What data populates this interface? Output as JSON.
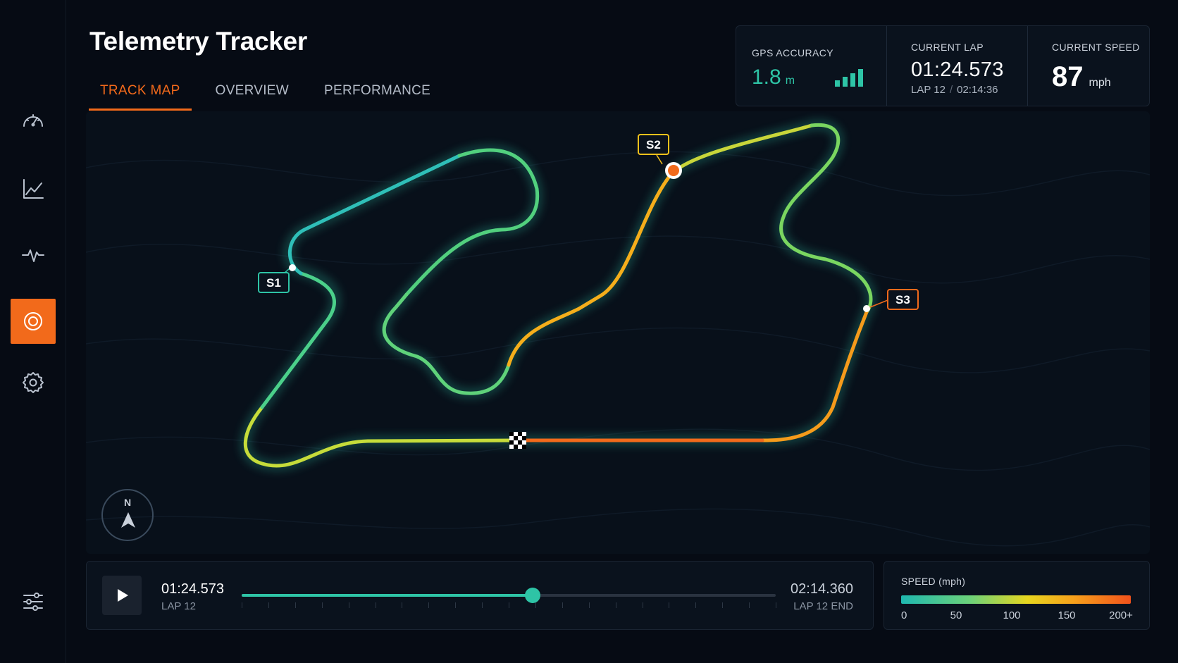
{
  "app": {
    "title": "Telemetry Tracker"
  },
  "sidebar": {
    "items": [
      {
        "id": "dashboard",
        "icon": "speedometer-icon",
        "active": false
      },
      {
        "id": "analytics",
        "icon": "line-chart-icon",
        "active": false
      },
      {
        "id": "telemetry",
        "icon": "pulse-icon",
        "active": false
      },
      {
        "id": "track",
        "icon": "target-icon",
        "active": true
      },
      {
        "id": "settings",
        "icon": "gear-icon",
        "active": false
      },
      {
        "id": "filters",
        "icon": "sliders-icon",
        "active": false
      }
    ]
  },
  "tabs": [
    {
      "label": "TRACK MAP",
      "active": true
    },
    {
      "label": "OVERVIEW",
      "active": false
    },
    {
      "label": "PERFORMANCE",
      "active": false
    }
  ],
  "stats": {
    "gps": {
      "label": "GPS ACCURACY",
      "value": "1.8",
      "unit": "m",
      "signal_bars": 4
    },
    "lap": {
      "label": "CURRENT LAP",
      "time": "01:24.573",
      "lap": "LAP 12",
      "total": "02:14:36"
    },
    "speed": {
      "label": "CURRENT SPEED",
      "value": "87",
      "unit": "mph"
    }
  },
  "map": {
    "sectors": [
      {
        "label": "S1",
        "color": "#2ec4a6"
      },
      {
        "label": "S2",
        "color": "#f5c21b"
      },
      {
        "label": "S3",
        "color": "#f26a1b"
      }
    ],
    "compass": {
      "label": "N"
    }
  },
  "playback": {
    "current_time": "01:24.573",
    "current_lap": "LAP 12",
    "end_time": "02:14.360",
    "end_label": "LAP 12 END",
    "progress": 0.545
  },
  "legend": {
    "title": "SPEED (mph)",
    "ticks": [
      "0",
      "50",
      "100",
      "150",
      "200+"
    ]
  },
  "colors": {
    "accent": "#f26a1b",
    "teal": "#2ec4a6",
    "background": "#060b14",
    "panel": "#0a121d"
  }
}
